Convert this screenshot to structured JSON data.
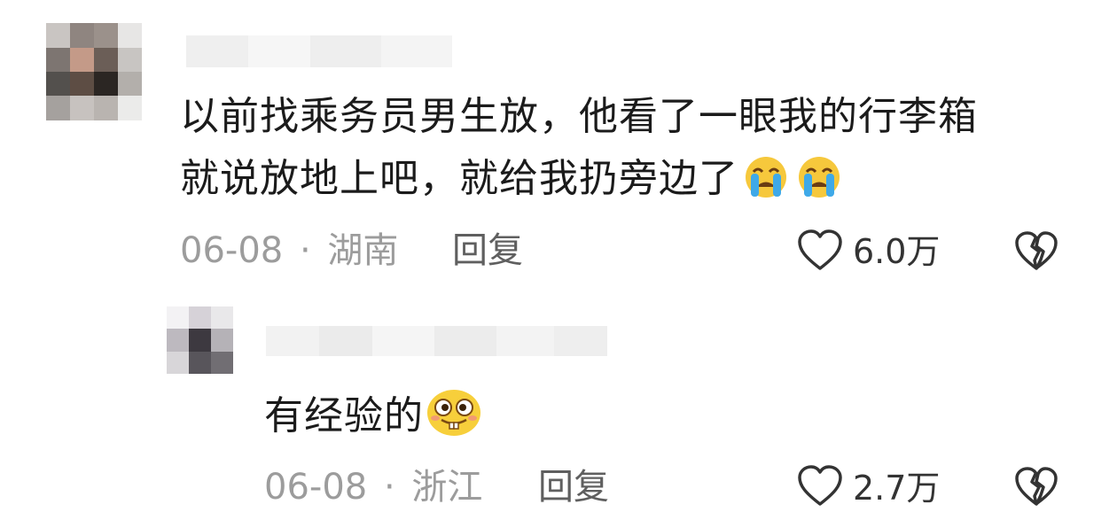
{
  "comments": [
    {
      "text_line1": "以前找乘务员男生放，他看了一眼我的行李箱",
      "text_line2": "就说放地上吧，就给我扔旁边了",
      "emojis": [
        "crying-face-emoji",
        "crying-face-emoji"
      ],
      "date": "06-08",
      "sep": "·",
      "location": "湖南",
      "reply_label": "回复",
      "likes": "6.0万"
    },
    {
      "text_line1": "有经验的",
      "emojis": [
        "grinning-buck-teeth-emoji"
      ],
      "date": "06-08",
      "sep": "·",
      "location": "浙江",
      "reply_label": "回复",
      "likes": "2.7万"
    }
  ],
  "colors": {
    "text": "#1b1b1b",
    "meta": "#9c9c9c",
    "reply": "#5f5f5f",
    "icon": "#333333"
  }
}
